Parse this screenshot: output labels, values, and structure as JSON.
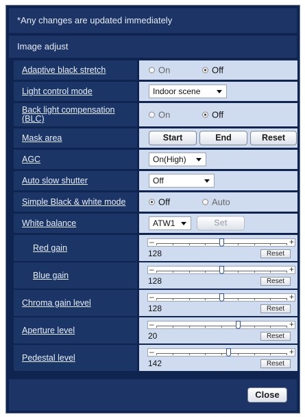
{
  "notice": "*Any changes are updated immediately",
  "section_title": "Image adjust",
  "adaptive_black_stretch": {
    "label": "Adaptive black stretch",
    "on": "On",
    "off": "Off",
    "selected": "Off"
  },
  "light_control_mode": {
    "label": "Light control mode",
    "value": "Indoor scene"
  },
  "blc": {
    "label": "Back light compensation (BLC)",
    "on": "On",
    "off": "Off",
    "selected": "Off"
  },
  "mask_area": {
    "label": "Mask area",
    "start": "Start",
    "end": "End",
    "reset": "Reset"
  },
  "agc": {
    "label": "AGC",
    "value": "On(High)"
  },
  "auto_slow_shutter": {
    "label": "Auto slow shutter",
    "value": "Off"
  },
  "simple_bw": {
    "label": "Simple Black & white mode",
    "off": "Off",
    "auto": "Auto",
    "selected": "Off"
  },
  "white_balance": {
    "label": "White balance",
    "value": "ATW1",
    "set": "Set"
  },
  "sliders": [
    {
      "label": "Red gain",
      "value": "128",
      "fraction": 0.5,
      "reset": "Reset"
    },
    {
      "label": "Blue gain",
      "value": "128",
      "fraction": 0.5,
      "reset": "Reset"
    },
    {
      "label": "Chroma gain level",
      "value": "128",
      "fraction": 0.5,
      "reset": "Reset"
    },
    {
      "label": "Aperture level",
      "value": "20",
      "fraction": 0.625,
      "reset": "Reset"
    },
    {
      "label": "Pedestal level",
      "value": "142",
      "fraction": 0.55,
      "reset": "Reset"
    }
  ],
  "close": "Close"
}
